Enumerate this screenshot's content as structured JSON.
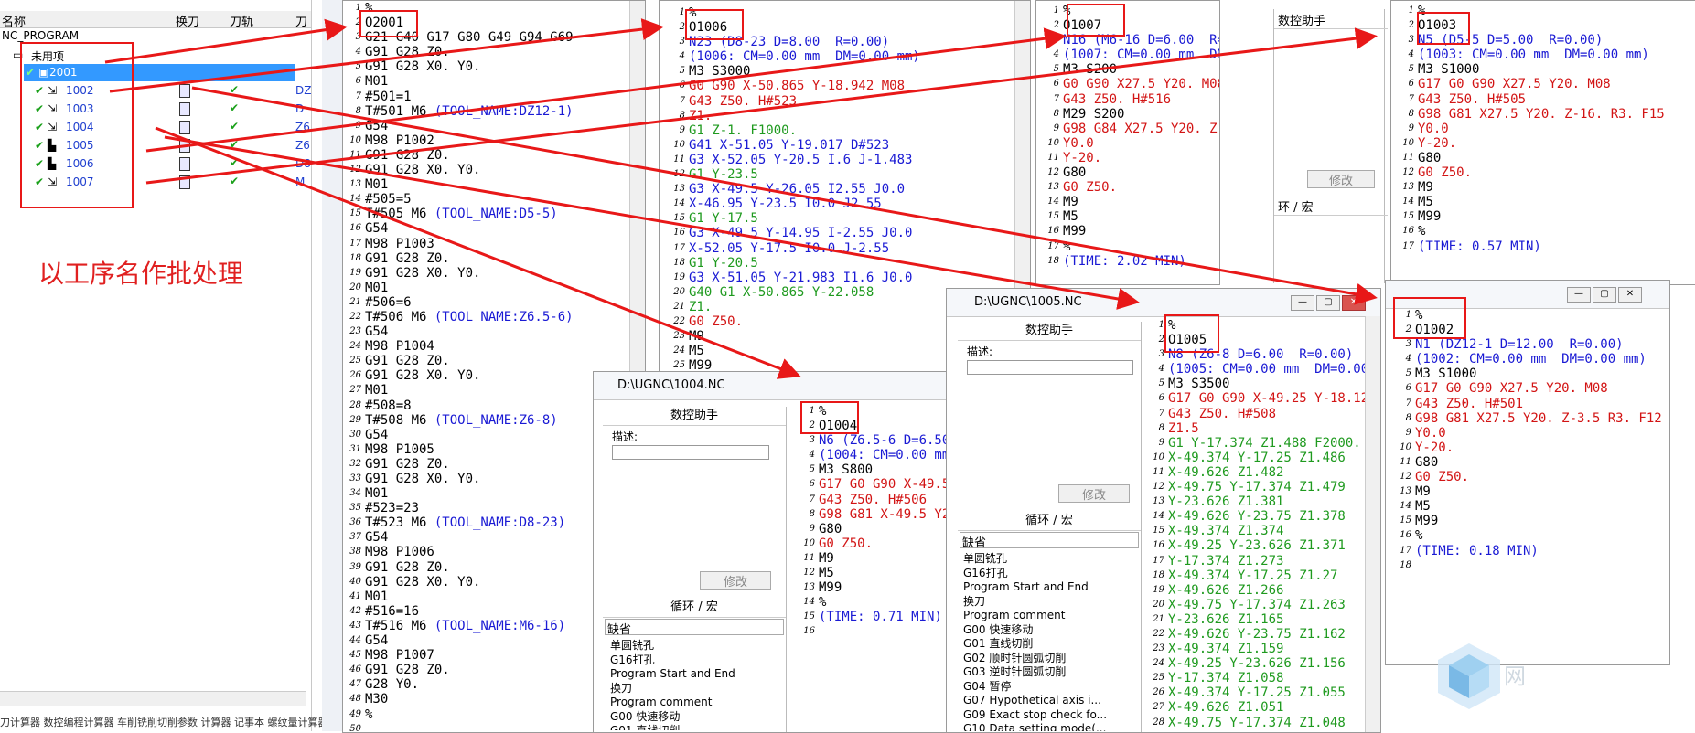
{
  "nav": {
    "columns": [
      "名称",
      "换刀",
      "刀轨",
      "刀"
    ],
    "root": "NC_PROGRAM",
    "unused": "未用项",
    "program": "2001",
    "ops": [
      "1002",
      "1003",
      "1004",
      "1005",
      "1006",
      "1007"
    ],
    "tool_ref_1": "DZ",
    "tool_ref_2": "D",
    "tool_ref_3": "Z6",
    "tool_ref_4": "Z6",
    "tool_ref_5": "D8",
    "tool_ref_6": "M",
    "status": "刀计算器  数控编程计算器  车削铣削切削参数  计算器  记事本  螺纹量计算器"
  },
  "annotation": "以工序名作批处理",
  "win_main": {
    "lines": [
      [
        [
          "k",
          "%"
        ]
      ],
      [
        [
          "k",
          "O2001"
        ]
      ],
      [
        [
          "k",
          "G21 G40 G17 G80 G49 G94 G69"
        ]
      ],
      [
        [
          "k",
          "G91 G28 Z0."
        ]
      ],
      [
        [
          "k",
          "G91 G28 X0. Y0."
        ]
      ],
      [
        [
          "k",
          "M01"
        ]
      ],
      [
        [
          "k",
          "#501=1"
        ]
      ],
      [
        [
          "k",
          "T#501 M6 "
        ],
        [
          "b",
          "(TOOL_NAME:DZ12-1)"
        ]
      ],
      [
        [
          "k",
          "G54"
        ]
      ],
      [
        [
          "k",
          "M98 P1002"
        ]
      ],
      [
        [
          "k",
          "G91 G28 Z0."
        ]
      ],
      [
        [
          "k",
          "G91 G28 X0. Y0."
        ]
      ],
      [
        [
          "k",
          "M01"
        ]
      ],
      [
        [
          "k",
          "#505=5"
        ]
      ],
      [
        [
          "k",
          "T#505 M6 "
        ],
        [
          "b",
          "(TOOL_NAME:D5-5)"
        ]
      ],
      [
        [
          "k",
          "G54"
        ]
      ],
      [
        [
          "k",
          "M98 P1003"
        ]
      ],
      [
        [
          "k",
          "G91 G28 Z0."
        ]
      ],
      [
        [
          "k",
          "G91 G28 X0. Y0."
        ]
      ],
      [
        [
          "k",
          "M01"
        ]
      ],
      [
        [
          "k",
          "#506=6"
        ]
      ],
      [
        [
          "k",
          "T#506 M6 "
        ],
        [
          "b",
          "(TOOL_NAME:Z6.5-6)"
        ]
      ],
      [
        [
          "k",
          "G54"
        ]
      ],
      [
        [
          "k",
          "M98 P1004"
        ]
      ],
      [
        [
          "k",
          "G91 G28 Z0."
        ]
      ],
      [
        [
          "k",
          "G91 G28 X0. Y0."
        ]
      ],
      [
        [
          "k",
          "M01"
        ]
      ],
      [
        [
          "k",
          "#508=8"
        ]
      ],
      [
        [
          "k",
          "T#508 M6 "
        ],
        [
          "b",
          "(TOOL_NAME:Z6-8)"
        ]
      ],
      [
        [
          "k",
          "G54"
        ]
      ],
      [
        [
          "k",
          "M98 P1005"
        ]
      ],
      [
        [
          "k",
          "G91 G28 Z0."
        ]
      ],
      [
        [
          "k",
          "G91 G28 X0. Y0."
        ]
      ],
      [
        [
          "k",
          "M01"
        ]
      ],
      [
        [
          "k",
          "#523=23"
        ]
      ],
      [
        [
          "k",
          "T#523 M6 "
        ],
        [
          "b",
          "(TOOL_NAME:D8-23)"
        ]
      ],
      [
        [
          "k",
          "G54"
        ]
      ],
      [
        [
          "k",
          "M98 P1006"
        ]
      ],
      [
        [
          "k",
          "G91 G28 Z0."
        ]
      ],
      [
        [
          "k",
          "G91 G28 X0. Y0."
        ]
      ],
      [
        [
          "k",
          "M01"
        ]
      ],
      [
        [
          "k",
          "#516=16"
        ]
      ],
      [
        [
          "k",
          "T#516 M6 "
        ],
        [
          "b",
          "(TOOL_NAME:M6-16)"
        ]
      ],
      [
        [
          "k",
          "G54"
        ]
      ],
      [
        [
          "k",
          "M98 P1007"
        ]
      ],
      [
        [
          "k",
          "G91 G28 Z0."
        ]
      ],
      [
        [
          "k",
          "G28 Y0."
        ]
      ],
      [
        [
          "k",
          "M30"
        ]
      ],
      [
        [
          "k",
          "%"
        ]
      ],
      [
        [
          "k",
          ""
        ]
      ]
    ]
  },
  "win_1006": {
    "lines": [
      [
        [
          "k",
          "%"
        ]
      ],
      [
        [
          "k",
          "O1006"
        ]
      ],
      [
        [
          "b",
          "N23 (D8-23 D=8.00  R=0.00)"
        ]
      ],
      [
        [
          "b",
          "(1006: CM=0.00 mm  DM=0.00 mm)"
        ]
      ],
      [
        [
          "k",
          "M3 S3000"
        ]
      ],
      [
        [
          "r",
          "G0 G90 X-50.865 Y-18.942 M08"
        ]
      ],
      [
        [
          "r",
          "G43 Z50. H#523"
        ]
      ],
      [
        [
          "r",
          "Z1."
        ]
      ],
      [
        [
          "g",
          "G1 Z-1. F1000."
        ]
      ],
      [
        [
          "b",
          "G41 X-51.05 Y-19.017 D#523"
        ]
      ],
      [
        [
          "b",
          "G3 X-52.05 Y-20.5 I.6 J-1.483"
        ]
      ],
      [
        [
          "g",
          "G1 Y-23.5"
        ]
      ],
      [
        [
          "b",
          "G3 X-49.5 Y-26.05 I2.55 J0.0"
        ]
      ],
      [
        [
          "b",
          "X-46.95 Y-23.5 I0.0 J2.55"
        ]
      ],
      [
        [
          "g",
          "G1 Y-17.5"
        ]
      ],
      [
        [
          "b",
          "G3 X-49.5 Y-14.95 I-2.55 J0.0"
        ]
      ],
      [
        [
          "b",
          "X-52.05 Y-17.5 I0.0 J-2.55"
        ]
      ],
      [
        [
          "g",
          "G1 Y-20.5"
        ]
      ],
      [
        [
          "b",
          "G3 X-51.05 Y-21.983 I1.6 J0.0"
        ]
      ],
      [
        [
          "g",
          "G40 G1 X-50.865 Y-22.058"
        ]
      ],
      [
        [
          "g",
          "Z1."
        ]
      ],
      [
        [
          "r",
          "G0 Z50."
        ]
      ],
      [
        [
          "k",
          "M9"
        ]
      ],
      [
        [
          "k",
          "M5"
        ]
      ],
      [
        [
          "k",
          "M99"
        ]
      ]
    ]
  },
  "win_1007": {
    "lines": [
      [
        [
          "k",
          "%"
        ]
      ],
      [
        [
          "k",
          "O1007"
        ]
      ],
      [
        [
          "b",
          "N16 (M6-16 D=6.00  R=0."
        ]
      ],
      [
        [
          "b",
          "(1007: CM=0.00 mm  DM="
        ]
      ],
      [
        [
          "k",
          "M3 S200"
        ]
      ],
      [
        [
          "r",
          "G0 G90 X27.5 Y20. M08"
        ]
      ],
      [
        [
          "r",
          "G43 Z50. H#516"
        ]
      ],
      [
        [
          "k",
          "M29 S200"
        ]
      ],
      [
        [
          "r",
          "G98 G84 X27.5 Y20. Z-1"
        ]
      ],
      [
        [
          "r",
          "Y0.0"
        ]
      ],
      [
        [
          "r",
          "Y-20."
        ]
      ],
      [
        [
          "k",
          "G80"
        ]
      ],
      [
        [
          "r",
          "G0 Z50."
        ]
      ],
      [
        [
          "k",
          "M9"
        ]
      ],
      [
        [
          "k",
          "M5"
        ]
      ],
      [
        [
          "k",
          "M99"
        ]
      ],
      [
        [
          "k",
          "%"
        ]
      ],
      [
        [
          "b",
          "(TIME: 2.02 MIN)"
        ]
      ]
    ]
  },
  "win_1003": {
    "lines": [
      [
        [
          "k",
          "%"
        ]
      ],
      [
        [
          "k",
          "O1003"
        ]
      ],
      [
        [
          "b",
          "N5 (D5-5 D=5.00  R=0.00)"
        ]
      ],
      [
        [
          "b",
          "(1003: CM=0.00 mm  DM=0.00 mm)"
        ]
      ],
      [
        [
          "k",
          "M3 S1000"
        ]
      ],
      [
        [
          "r",
          "G17 G0 G90 X27.5 Y20. M08"
        ]
      ],
      [
        [
          "r",
          "G43 Z50. H#505"
        ]
      ],
      [
        [
          "r",
          "G98 G81 X27.5 Y20. Z-16. R3. F15"
        ]
      ],
      [
        [
          "r",
          "Y0.0"
        ]
      ],
      [
        [
          "r",
          "Y-20."
        ]
      ],
      [
        [
          "k",
          "G80"
        ]
      ],
      [
        [
          "r",
          "G0 Z50."
        ]
      ],
      [
        [
          "k",
          "M9"
        ]
      ],
      [
        [
          "k",
          "M5"
        ]
      ],
      [
        [
          "k",
          "M99"
        ]
      ],
      [
        [
          "k",
          "%"
        ]
      ],
      [
        [
          "b",
          "(TIME: 0.57 MIN)"
        ]
      ]
    ]
  },
  "win_1004": {
    "title": "D:\\UGNC\\1004.NC",
    "lines": [
      [
        [
          "k",
          "%"
        ]
      ],
      [
        [
          "k",
          "O1004"
        ]
      ],
      [
        [
          "b",
          "N6 (Z6.5-6 D=6.50  R"
        ]
      ],
      [
        [
          "b",
          "(1004: CM=0.00 mm  D"
        ]
      ],
      [
        [
          "k",
          "M3 S800"
        ]
      ],
      [
        [
          "r",
          "G17 G0 G90 X-49.5 Y2"
        ]
      ],
      [
        [
          "r",
          "G43 Z50. H#506"
        ]
      ],
      [
        [
          "r",
          "G98 G81 X-49.5 Y20.5"
        ]
      ],
      [
        [
          "k",
          "G80"
        ]
      ],
      [
        [
          "r",
          "G0 Z50."
        ]
      ],
      [
        [
          "k",
          "M9"
        ]
      ],
      [
        [
          "k",
          "M5"
        ]
      ],
      [
        [
          "k",
          "M99"
        ]
      ],
      [
        [
          "k",
          "%"
        ]
      ],
      [
        [
          "b",
          "(TIME: 0.71 MIN)"
        ]
      ],
      [
        [
          "k",
          ""
        ]
      ]
    ]
  },
  "win_1005": {
    "title": "D:\\UGNC\\1005.NC",
    "lines": [
      [
        [
          "k",
          "%"
        ]
      ],
      [
        [
          "k",
          "O1005"
        ]
      ],
      [
        [
          "b",
          "N8 (Z6-8 D=6.00  R=0.00)"
        ]
      ],
      [
        [
          "b",
          "(1005: CM=0.00 mm  DM=0.00 :"
        ]
      ],
      [
        [
          "k",
          "M3 S3500"
        ]
      ],
      [
        [
          "r",
          "G17 G0 G90 X-49.25 Y-18.12"
        ]
      ],
      [
        [
          "r",
          "G43 Z50. H#508"
        ]
      ],
      [
        [
          "r",
          "Z1.5"
        ]
      ],
      [
        [
          "g",
          "G1 Y-17.374 Z1.488 F2000."
        ]
      ],
      [
        [
          "g",
          "X-49.374 Y-17.25 Z1.486"
        ]
      ],
      [
        [
          "g",
          "X-49.626 Z1.482"
        ]
      ],
      [
        [
          "g",
          "X-49.75 Y-17.374 Z1.479"
        ]
      ],
      [
        [
          "g",
          "Y-23.626 Z1.381"
        ]
      ],
      [
        [
          "g",
          "X-49.626 Y-23.75 Z1.378"
        ]
      ],
      [
        [
          "g",
          "X-49.374 Z1.374"
        ]
      ],
      [
        [
          "g",
          "X-49.25 Y-23.626 Z1.371"
        ]
      ],
      [
        [
          "g",
          "Y-17.374 Z1.273"
        ]
      ],
      [
        [
          "g",
          "X-49.374 Y-17.25 Z1.27"
        ]
      ],
      [
        [
          "g",
          "X-49.626 Z1.266"
        ]
      ],
      [
        [
          "g",
          "X-49.75 Y-17.374 Z1.263"
        ]
      ],
      [
        [
          "g",
          "Y-23.626 Z1.165"
        ]
      ],
      [
        [
          "g",
          "X-49.626 Y-23.75 Z1.162"
        ]
      ],
      [
        [
          "g",
          "X-49.374 Z1.159"
        ]
      ],
      [
        [
          "g",
          "X-49.25 Y-23.626 Z1.156"
        ]
      ],
      [
        [
          "g",
          "Y-17.374 Z1.058"
        ]
      ],
      [
        [
          "g",
          "X-49.374 Y-17.25 Z1.055"
        ]
      ],
      [
        [
          "g",
          "X-49.626 Z1.051"
        ]
      ],
      [
        [
          "g",
          "X-49.75 Y-17.374 Z1.048"
        ]
      ]
    ]
  },
  "win_1002": {
    "lines": [
      [
        [
          "k",
          "%"
        ]
      ],
      [
        [
          "k",
          "O1002"
        ]
      ],
      [
        [
          "b",
          "N1 (DZ12-1 D=12.00  R=0.00)"
        ]
      ],
      [
        [
          "b",
          "(1002: CM=0.00 mm  DM=0.00 mm)"
        ]
      ],
      [
        [
          "k",
          "M3 S1000"
        ]
      ],
      [
        [
          "r",
          "G17 G0 G90 X27.5 Y20. M08"
        ]
      ],
      [
        [
          "r",
          "G43 Z50. H#501"
        ]
      ],
      [
        [
          "r",
          "G98 G81 X27.5 Y20. Z-3.5 R3. F12"
        ]
      ],
      [
        [
          "r",
          "Y0.0"
        ]
      ],
      [
        [
          "r",
          "Y-20."
        ]
      ],
      [
        [
          "k",
          "G80"
        ]
      ],
      [
        [
          "r",
          "G0 Z50."
        ]
      ],
      [
        [
          "k",
          "M9"
        ]
      ],
      [
        [
          "k",
          "M5"
        ]
      ],
      [
        [
          "k",
          "M99"
        ]
      ],
      [
        [
          "k",
          "%"
        ]
      ],
      [
        [
          "b",
          "(TIME: 0.18 MIN)"
        ]
      ],
      [
        [
          "k",
          ""
        ]
      ]
    ]
  },
  "assist": {
    "title": "数控助手",
    "desc_label": "描述:",
    "modify": "修改",
    "cycle_label": "循环 / 宏",
    "cycle_label_short": "环 / 宏",
    "default": "缺省",
    "items_1004": [
      "单圆铣孔",
      "G16打孔",
      "Program Start and End",
      "换刀",
      "Program comment",
      "G00 快速移动",
      "G01 直线切削"
    ],
    "items_1005": [
      "单圆铣孔",
      "G16打孔",
      "Program Start and End",
      "换刀",
      "Program comment",
      "G00 快速移动",
      "G01 直线切削",
      "G02 顺时针圆弧切削",
      "G03 逆时针圆弧切削",
      "G04 暂停",
      "G07 Hypothetical axis i...",
      "G09 Exact stop check fo...",
      "G10 Data setting mode(..."
    ]
  },
  "watermark": "网"
}
